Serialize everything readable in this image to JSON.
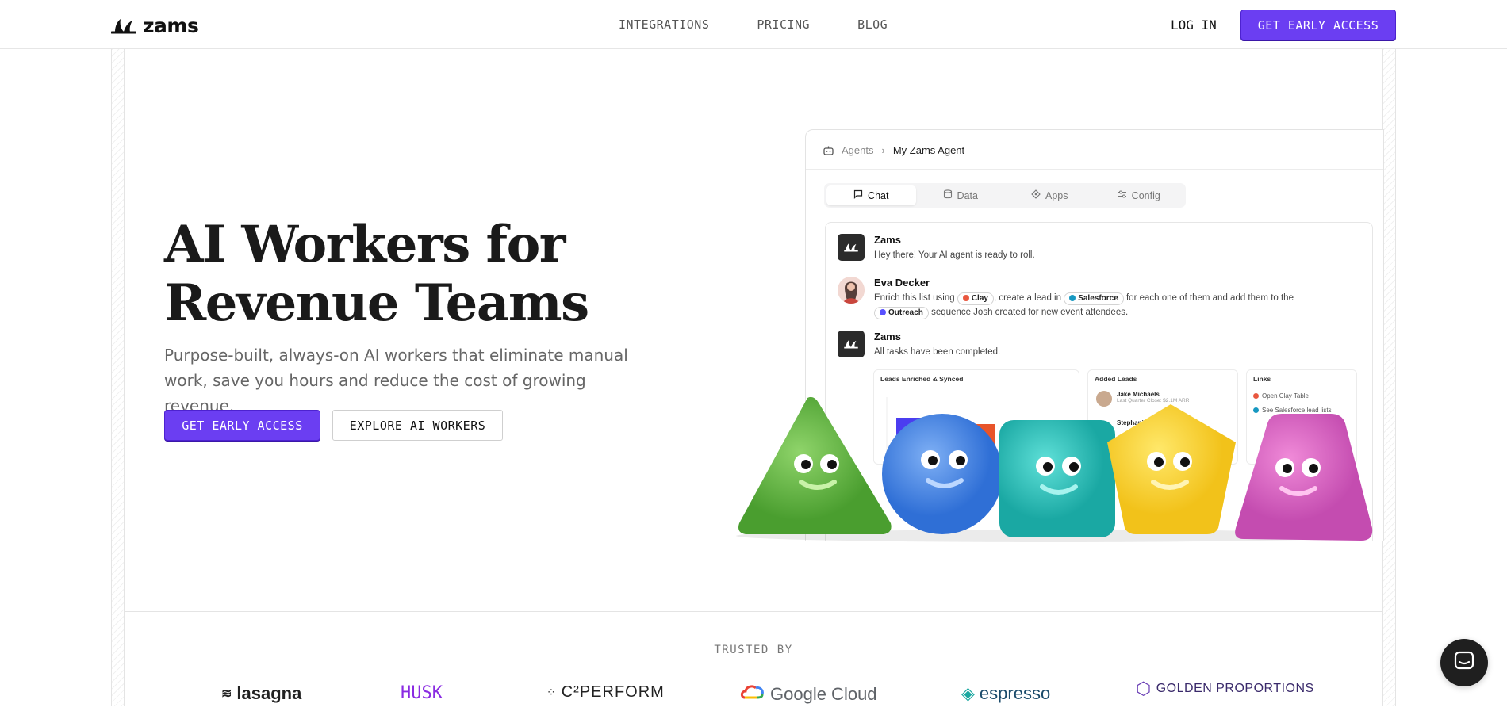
{
  "nav": {
    "logo_text": "zams",
    "links": [
      "INTEGRATIONS",
      "PRICING",
      "BLOG"
    ],
    "login": "LOG IN",
    "cta": "GET EARLY ACCESS"
  },
  "hero": {
    "title": "AI Workers for Revenue Teams",
    "subtitle": "Purpose-built, always-on AI workers that eliminate manual work, save you hours and reduce the cost of growing revenue.",
    "cta_primary": "GET EARLY ACCESS",
    "cta_secondary": "EXPLORE AI WORKERS"
  },
  "app": {
    "breadcrumb": [
      "Agents",
      "My Zams Agent"
    ],
    "tabs": [
      "Chat",
      "Data",
      "Apps",
      "Config"
    ],
    "active_tab": "Chat",
    "messages": [
      {
        "name": "Zams",
        "text": "Hey there! Your AI agent is ready to roll."
      },
      {
        "name": "Eva Decker",
        "text_a": "Enrich this list using",
        "pill_clay": "Clay",
        "text_b": ", create a lead in",
        "pill_salesforce": "Salesforce",
        "text_c": "for each one of them and add them to the",
        "pill_outreach": "Outreach",
        "text_d": "sequence Josh created for new event attendees."
      },
      {
        "name": "Zams",
        "text": "All tasks have been completed."
      }
    ],
    "panels": {
      "leads_title": "Leads Enriched & Synced",
      "added_title": "Added Leads",
      "added_1_name": "Jake Michaels",
      "added_1_sub": "Last Quarter Close: $2.1M ARR",
      "added_2_name": "Stephanie",
      "links_title": "Links",
      "link_1": "Open Clay Table",
      "link_2": "See Salesforce lead lists"
    }
  },
  "trusted": {
    "label": "TRUSTED BY",
    "logos": [
      "lasagna",
      "HUSK",
      "C²PERFORM",
      "Google Cloud",
      "espresso",
      "GOLDEN PROPORTIONS"
    ]
  },
  "colors": {
    "accent": "#6b3ef2",
    "text": "#1a1a1a",
    "muted": "#666666"
  }
}
